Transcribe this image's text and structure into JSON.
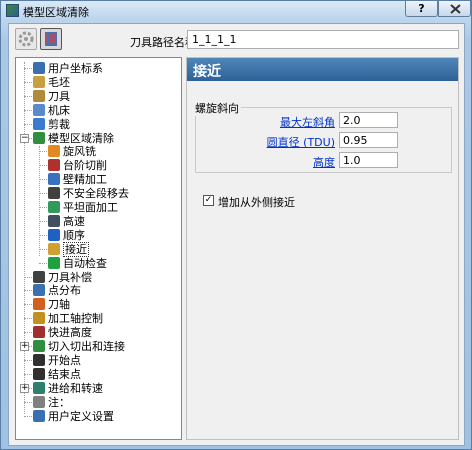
{
  "window": {
    "title": "模型区域清除"
  },
  "titlebar": {
    "help_label": "?"
  },
  "toolbar": {
    "path_label": "刀具路径名称",
    "path_value": "1_1_1_1"
  },
  "tree": {
    "items": [
      {
        "label": "用户坐标系",
        "icon": "ucs-icon",
        "color": "#3a6fb0"
      },
      {
        "label": "毛坯",
        "icon": "block-icon",
        "color": "#c8a040"
      },
      {
        "label": "刀具",
        "icon": "tool-icon",
        "color": "#b08a3a"
      },
      {
        "label": "机床",
        "icon": "machine-icon",
        "color": "#5a8acb"
      },
      {
        "label": "剪裁",
        "icon": "trim-icon",
        "color": "#3a7ad0"
      },
      {
        "label": "模型区域清除",
        "icon": "area-clear-icon",
        "color": "#2f8f3f"
      },
      {
        "label": "旋风铣",
        "icon": "vortex-icon",
        "color": "#e08a20"
      },
      {
        "label": "台阶切削",
        "icon": "step-cut-icon",
        "color": "#b03030"
      },
      {
        "label": "壁精加工",
        "icon": "wall-finish-icon",
        "color": "#3a70c0"
      },
      {
        "label": "不安全段移去",
        "icon": "unsafe-removal-icon",
        "color": "#404040"
      },
      {
        "label": "平坦面加工",
        "icon": "flat-machining-icon",
        "color": "#2f9a5a"
      },
      {
        "label": "高速",
        "icon": "high-speed-icon",
        "color": "#405060"
      },
      {
        "label": "顺序",
        "icon": "order-icon",
        "color": "#2060c0"
      },
      {
        "label": "接近",
        "icon": "approach-icon",
        "color": "#d0a030"
      },
      {
        "label": "自动检查",
        "icon": "auto-verify-icon",
        "color": "#20a040"
      },
      {
        "label": "刀具补偿",
        "icon": "tool-compensation-icon",
        "color": "#404040"
      },
      {
        "label": "点分布",
        "icon": "point-distribution-icon",
        "color": "#3a6fb0"
      },
      {
        "label": "刀轴",
        "icon": "tool-axis-icon",
        "color": "#d06020"
      },
      {
        "label": "加工轴控制",
        "icon": "axis-control-icon",
        "color": "#c09020"
      },
      {
        "label": "快进高度",
        "icon": "rapid-height-icon",
        "color": "#a03030"
      },
      {
        "label": "切入切出和连接",
        "icon": "leads-links-icon",
        "color": "#2f8f3f"
      },
      {
        "label": "开始点",
        "icon": "start-point-icon",
        "color": "#303030"
      },
      {
        "label": "结束点",
        "icon": "end-point-icon",
        "color": "#303030"
      },
      {
        "label": "进给和转速",
        "icon": "feeds-speeds-icon",
        "color": "#2f7f6f"
      },
      {
        "label": "注：",
        "icon": "notes-icon",
        "color": "#808080"
      },
      {
        "label": "用户定义设置",
        "icon": "user-settings-icon",
        "color": "#3a6fb0"
      }
    ]
  },
  "panel": {
    "title": "接近",
    "group_title": "螺旋斜向",
    "fields": [
      {
        "label": "最大左斜角",
        "value": "2.0"
      },
      {
        "label": "圆直径 (TDU)",
        "value": "0.95"
      },
      {
        "label": "高度",
        "value": "1.0"
      }
    ],
    "checkbox_label": "增加从外侧接近",
    "checkbox_mark": "✓"
  },
  "colors": {
    "header": "#2e6198",
    "link": "#0033cc"
  }
}
